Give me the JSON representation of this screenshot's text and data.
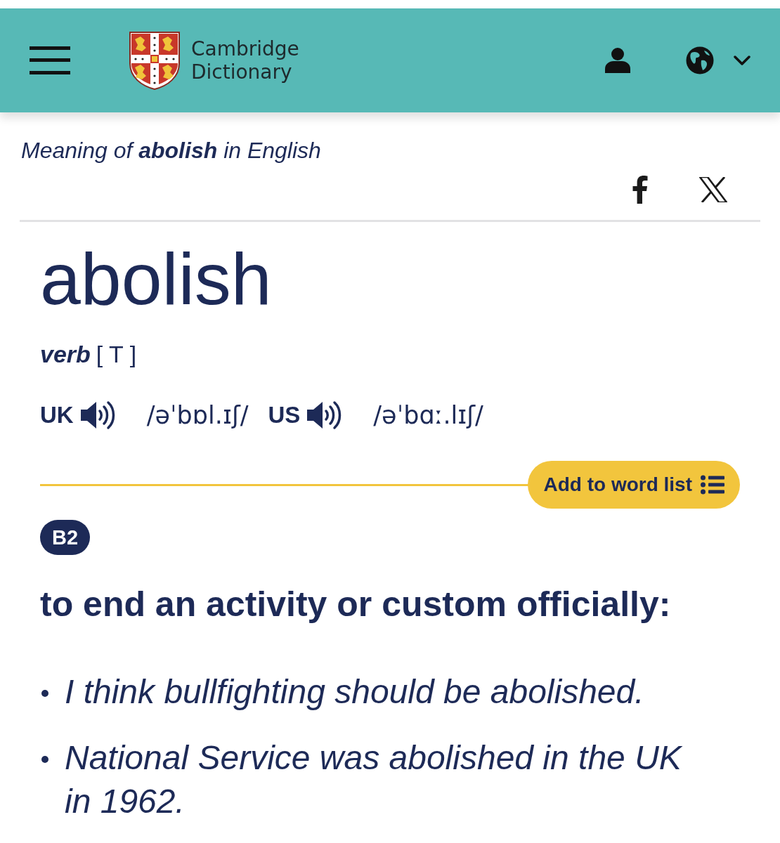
{
  "header": {
    "brand": "Cambridge Dictionary"
  },
  "entry": {
    "heading": "Meaning of **abolish** in English",
    "headword": "abolish",
    "pos": "verb",
    "grammar": "[ T ]",
    "pronunciations": [
      {
        "region": "UK",
        "ipa": "/əˈbɒl.ɪʃ/"
      },
      {
        "region": "US",
        "ipa": "/əˈbɑː.lɪʃ/"
      }
    ],
    "add_button": "Add to word list",
    "cefr": "B2",
    "definition": "to end an activity or custom officially:",
    "examples": [
      "I think bullfighting should be abolished.",
      "National Service was abolished in the UK in 1962."
    ]
  }
}
